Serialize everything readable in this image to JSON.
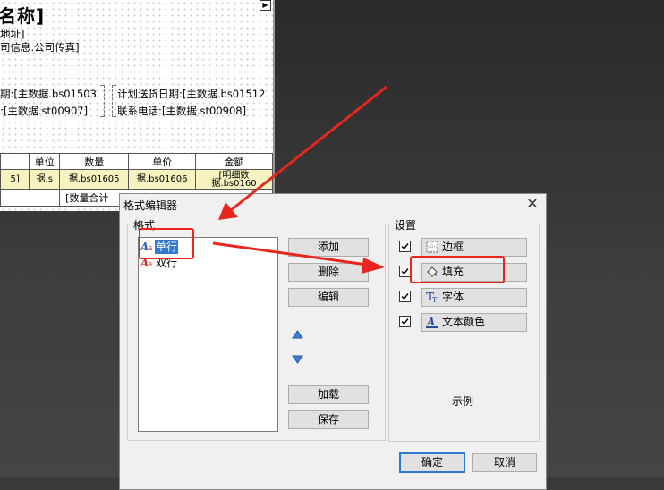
{
  "report": {
    "title": "名称]",
    "line_address": "地址]",
    "line_company": "司信息.公司传真]",
    "field1": "期:[主数据.bs01503",
    "field2": "计划送货日期:[主数据.bs01512",
    "field3": ":[主数据.st00907]",
    "field4": "联系电话:[主数据.st00908]",
    "table_headers": [
      "",
      "单位",
      "数量",
      "单价",
      "金额"
    ],
    "detail_row": [
      "5]",
      "据.s",
      "据.bs01605",
      "据.bs01606",
      "据.bs0160"
    ],
    "detail_row_top": [
      "",
      "",
      "",
      "",
      "[明细数"
    ],
    "footer_text": "[数量合计"
  },
  "dialog": {
    "title": "格式编辑器",
    "close_glyph": "✕",
    "format_group_label": "格式",
    "settings_group_label": "设置",
    "format_items": [
      {
        "label": "单行",
        "selected": true
      },
      {
        "label": "双行",
        "selected": false
      }
    ],
    "buttons": {
      "add": "添加",
      "delete": "删除",
      "edit": "编辑",
      "load": "加载",
      "save": "保存",
      "ok": "确定",
      "cancel": "取消"
    },
    "settings": [
      {
        "label": "边框",
        "checked": true,
        "icon": "border-icon"
      },
      {
        "label": "填充",
        "checked": true,
        "icon": "fill-icon"
      },
      {
        "label": "字体",
        "checked": true,
        "icon": "font-icon"
      },
      {
        "label": "文本颜色",
        "checked": true,
        "icon": "text-color-icon"
      }
    ],
    "preview_label": "示例"
  },
  "colors": {
    "annotation": "#e8261e",
    "selection": "#3078d0",
    "detail_band": "#f7f3c0"
  }
}
